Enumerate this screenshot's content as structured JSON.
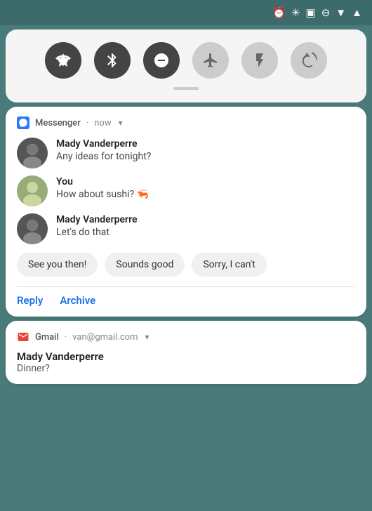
{
  "statusBar": {
    "icons": [
      "alarm-icon",
      "bluetooth-icon",
      "cast-icon",
      "dnd-icon",
      "wifi-icon",
      "signal-icon"
    ]
  },
  "quickSettings": {
    "tiles": [
      {
        "name": "wifi-tile",
        "label": "WiFi",
        "active": true
      },
      {
        "name": "bluetooth-tile",
        "label": "Bluetooth",
        "active": true
      },
      {
        "name": "dnd-tile",
        "label": "Do Not Disturb",
        "active": true
      },
      {
        "name": "airplane-tile",
        "label": "Airplane Mode",
        "active": false
      },
      {
        "name": "flashlight-tile",
        "label": "Flashlight",
        "active": false
      },
      {
        "name": "rotate-tile",
        "label": "Auto Rotate",
        "active": false
      }
    ]
  },
  "messengerNotification": {
    "appName": "Messenger",
    "time": "now",
    "messages": [
      {
        "sender": "Mady Vanderperre",
        "text": "Any ideas for tonight?",
        "avatarType": "mady"
      },
      {
        "sender": "You",
        "text": "How about sushi? 🦐",
        "avatarType": "you"
      },
      {
        "sender": "Mady Vanderperre",
        "text": "Let's do that",
        "avatarType": "mady"
      }
    ],
    "quickReplies": [
      {
        "label": "See you then!"
      },
      {
        "label": "Sounds good"
      },
      {
        "label": "Sorry, I can't"
      }
    ],
    "actions": [
      {
        "label": "Reply"
      },
      {
        "label": "Archive"
      }
    ]
  },
  "gmailNotification": {
    "appName": "Gmail",
    "account": "van@gmail.com",
    "sender": "Mady Vanderperre",
    "subject": "Dinner?"
  }
}
